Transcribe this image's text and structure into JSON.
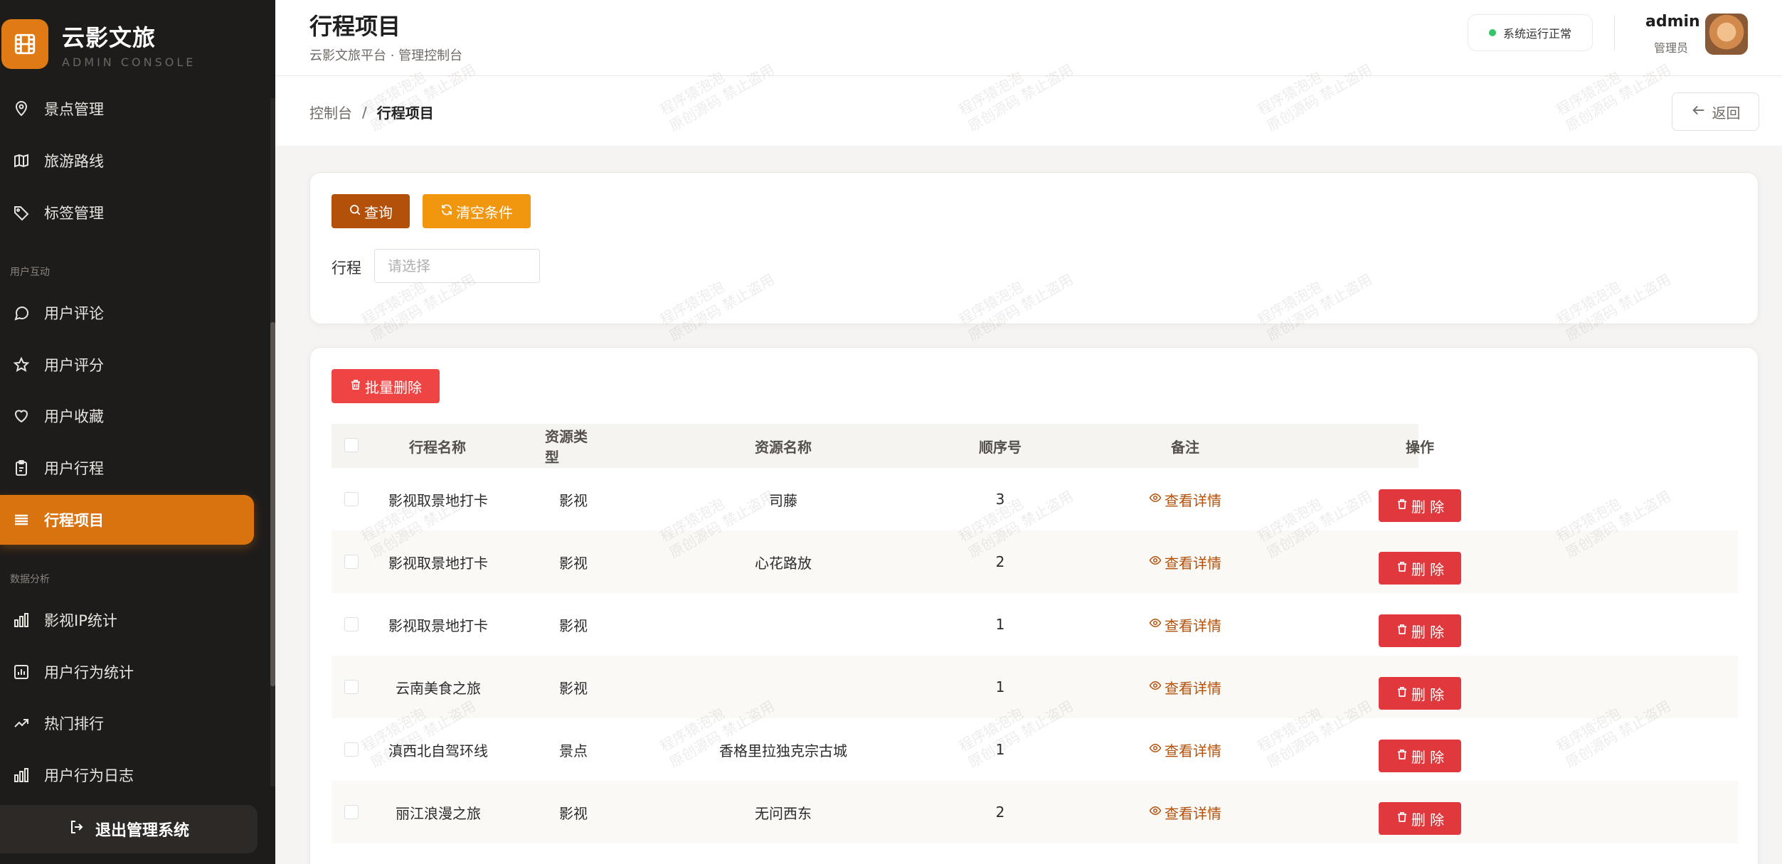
{
  "brand": {
    "title": "云影文旅",
    "subtitle": "ADMIN CONSOLE"
  },
  "sidebar": {
    "items_top": [
      {
        "label": "景点管理",
        "icon": "map-pin-icon"
      },
      {
        "label": "旅游路线",
        "icon": "map-icon"
      },
      {
        "label": "标签管理",
        "icon": "tag-icon"
      }
    ],
    "group_interaction": "用户互动",
    "items_interaction": [
      {
        "label": "用户评论",
        "icon": "comment-icon"
      },
      {
        "label": "用户评分",
        "icon": "star-icon"
      },
      {
        "label": "用户收藏",
        "icon": "heart-icon"
      },
      {
        "label": "用户行程",
        "icon": "clipboard-icon"
      },
      {
        "label": "行程项目",
        "icon": "list-icon",
        "active": true
      }
    ],
    "group_analysis": "数据分析",
    "items_analysis": [
      {
        "label": "影视IP统计",
        "icon": "bar-chart-icon"
      },
      {
        "label": "用户行为统计",
        "icon": "stats-icon"
      },
      {
        "label": "热门排行",
        "icon": "trending-icon"
      },
      {
        "label": "用户行为日志",
        "icon": "bar-chart-icon"
      }
    ],
    "logout_label": "退出管理系统"
  },
  "header": {
    "title": "行程项目",
    "subtitle": "云影文旅平台 · 管理控制台",
    "status": "系统运行正常",
    "user_name": "admin",
    "user_role": "管理员"
  },
  "breadcrumb": {
    "home": "控制台",
    "separator": "/",
    "current": "行程项目",
    "back_label": "返回"
  },
  "search": {
    "query_label": "查询",
    "clear_label": "清空条件",
    "field_label": "行程",
    "field_placeholder": "请选择",
    "field_value": ""
  },
  "table": {
    "batch_delete_label": "批量删除",
    "columns": [
      "行程名称",
      "资源类型",
      "资源名称",
      "顺序号",
      "备注",
      "操作"
    ],
    "view_label": "查看详情",
    "delete_label": "删 除",
    "rows": [
      {
        "name": "影视取景地打卡",
        "type": "影视",
        "resource": "司藤",
        "order": "3"
      },
      {
        "name": "影视取景地打卡",
        "type": "影视",
        "resource": "心花路放",
        "order": "2"
      },
      {
        "name": "影视取景地打卡",
        "type": "影视",
        "resource": "",
        "order": "1"
      },
      {
        "name": "云南美食之旅",
        "type": "影视",
        "resource": "",
        "order": "1"
      },
      {
        "name": "滇西北自驾环线",
        "type": "景点",
        "resource": "香格里拉独克宗古城",
        "order": "1"
      },
      {
        "name": "丽江浪漫之旅",
        "type": "影视",
        "resource": "无问西东",
        "order": "2"
      }
    ]
  },
  "watermark": {
    "line1": "程序猿泡泡",
    "line2": "原创源码 禁止盗用"
  },
  "colors": {
    "accent": "#d9730f",
    "query": "#b3500a",
    "clear": "#f0960f",
    "danger": "#e0383c",
    "sidebar": "#1e1c1b"
  }
}
